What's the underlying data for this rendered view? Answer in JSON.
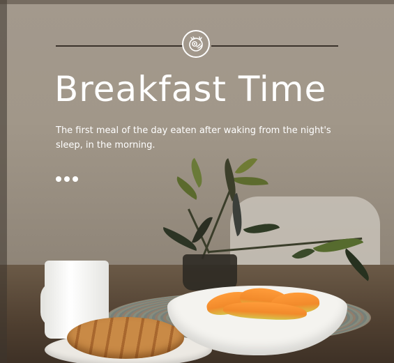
{
  "header": {
    "emblem_icon": "breakfast-plate-icon",
    "title": "Breakfast Time",
    "subtitle": "The first meal of the day eaten after waking from the night's sleep, in the morning."
  },
  "pager": {
    "dots_icon": "more-dots-icon",
    "dot_count": 3
  },
  "colors": {
    "text": "#ffffff",
    "divider": "#3a322b",
    "background": "#a19789"
  }
}
